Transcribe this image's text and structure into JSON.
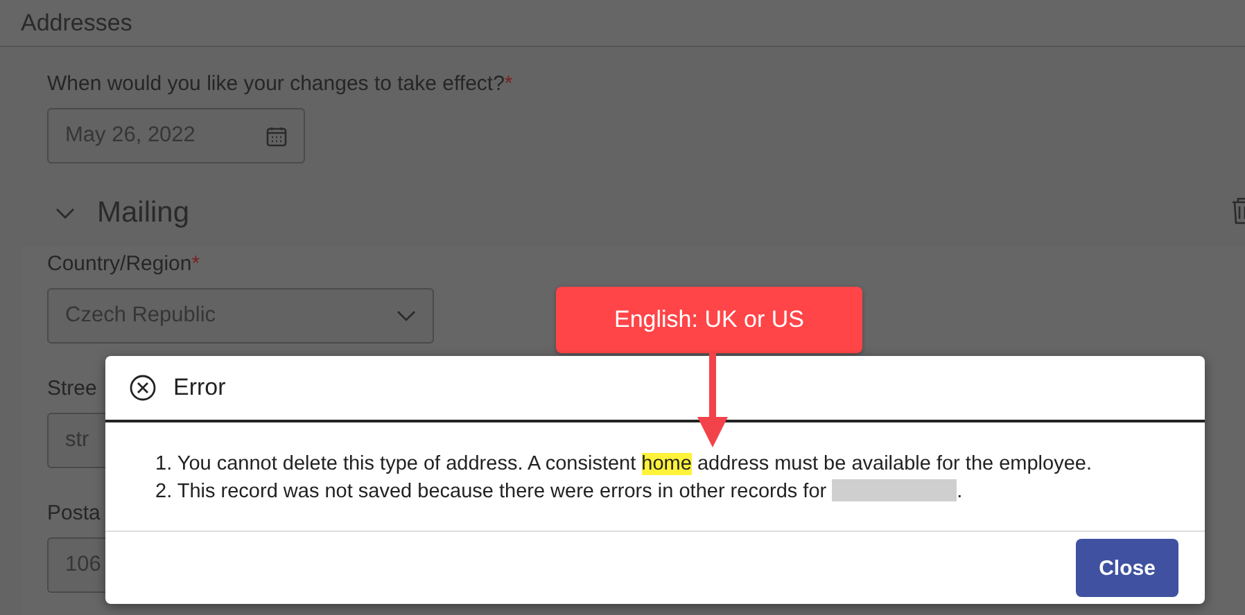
{
  "page_title": "Addresses",
  "effective_date": {
    "label": "When would you like your changes to take effect?",
    "required_mark": "*",
    "value": "May 26, 2022"
  },
  "section": {
    "title": "Mailing",
    "expanded": true
  },
  "fields": [
    {
      "label": "Country/Region",
      "required_mark": "*",
      "kind": "select",
      "value": "Czech Republic"
    },
    {
      "label": "Stree",
      "kind": "text",
      "value": "str"
    },
    {
      "label": "Posta",
      "kind": "text",
      "value": "106"
    }
  ],
  "dialog": {
    "title": "Error",
    "messages": [
      {
        "before": "1. You cannot delete this type of address. A consistent ",
        "highlight": "home",
        "after": " address must be available for the employee.",
        "redacted": false
      },
      {
        "before": "2. This record was not saved because there were errors in other records for ",
        "after": ".",
        "redacted": true
      }
    ],
    "button": "Close"
  },
  "callout": {
    "text": "English: UK or US"
  }
}
